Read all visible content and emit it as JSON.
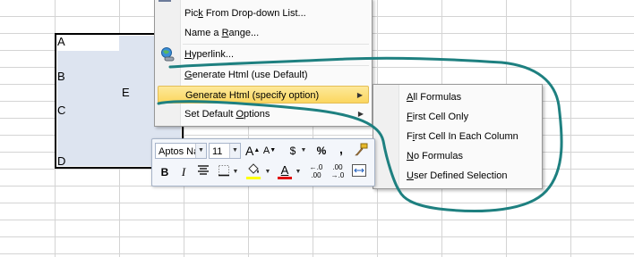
{
  "sheet": {
    "cells": {
      "a": "A",
      "b": "B",
      "c": "C",
      "d": "D",
      "e": "E"
    }
  },
  "context_menu": {
    "items": [
      {
        "pre": "Pic",
        "u": "k",
        "post": " From Drop-down List..."
      },
      {
        "pre": "Name a ",
        "u": "R",
        "post": "ange..."
      },
      {
        "pre": "",
        "u": "H",
        "post": "yperlink..."
      },
      {
        "pre": "",
        "u": "G",
        "post": "enerate Html (use Default)"
      },
      {
        "pre": "Generate Html (specify option)",
        "u": "",
        "post": ""
      },
      {
        "pre": "Set Default ",
        "u": "O",
        "post": "ptions"
      }
    ]
  },
  "submenu": {
    "items": [
      {
        "pre": "",
        "u": "A",
        "post": "ll Formulas"
      },
      {
        "pre": "",
        "u": "F",
        "post": "irst Cell Only"
      },
      {
        "pre": "F",
        "u": "i",
        "post": "rst Cell In Each Column"
      },
      {
        "pre": "",
        "u": "N",
        "post": "o Formulas"
      },
      {
        "pre": "",
        "u": "U",
        "post": "ser Defined Selection"
      }
    ]
  },
  "mini_toolbar": {
    "font_name": "Aptos Na",
    "font_size": "11",
    "grow_font": "A",
    "shrink_font": "A",
    "currency": "$",
    "percent": "%",
    "comma": ",",
    "bold": "B",
    "italic": "I",
    "font_color_glyph": "A",
    "inc_decimal": "←.0 .00",
    "dec_decimal": ".00 →.0"
  },
  "colors": {
    "annotation": "#1e8080",
    "highlight_fill": "#fbd65f",
    "fill_color": "#ffff00",
    "font_color": "#e01010"
  },
  "icons": [
    "hyperlink-icon",
    "submenu-arrow-icon",
    "format-painter-icon",
    "align-center-icon",
    "borders-icon",
    "fill-color-icon",
    "font-color-icon"
  ]
}
